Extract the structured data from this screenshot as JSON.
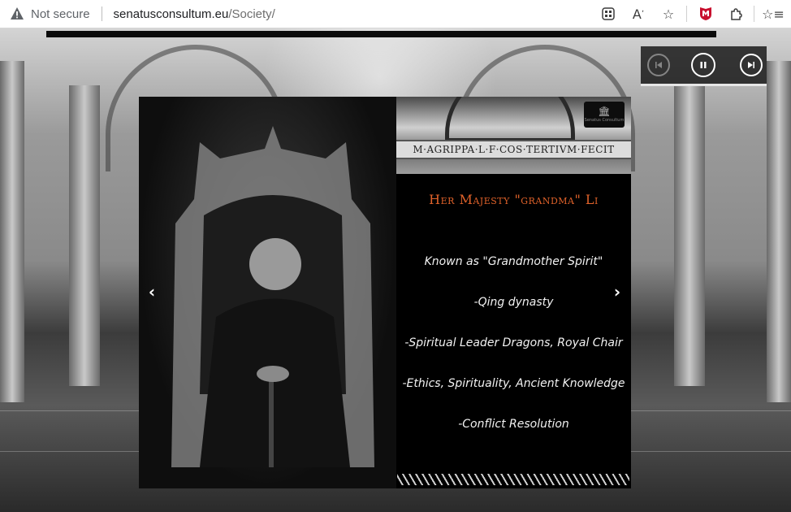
{
  "browser": {
    "security_label": "Not secure",
    "url_domain": "senatusconsultum.eu",
    "url_path": "/Society/",
    "icons": [
      "warning-icon",
      "apps-icon",
      "read-aloud-icon",
      "favorite-add-icon",
      "mcafee-icon",
      "extensions-icon",
      "favorites-icon"
    ]
  },
  "media": {
    "buttons": [
      "previous-icon",
      "pause-icon",
      "next-icon"
    ]
  },
  "slide": {
    "frieze_text": "M·AGRIPPA·L·F·COS·TERTIVM·FECIT",
    "logo_text": "Senatus Consultum",
    "title": "Her Majesty \"grandma\" Li",
    "lines": [
      "Known as \"Grandmother Spirit\"",
      "-Qing dynasty",
      "-Spiritual Leader Dragons, Royal Chair",
      "-Ethics, Spirituality, Ancient Knowledge",
      "-Conflict Resolution"
    ]
  },
  "colors": {
    "title": "#e0622a",
    "text": "#f2f2f2",
    "slide_bg": "#000000"
  }
}
